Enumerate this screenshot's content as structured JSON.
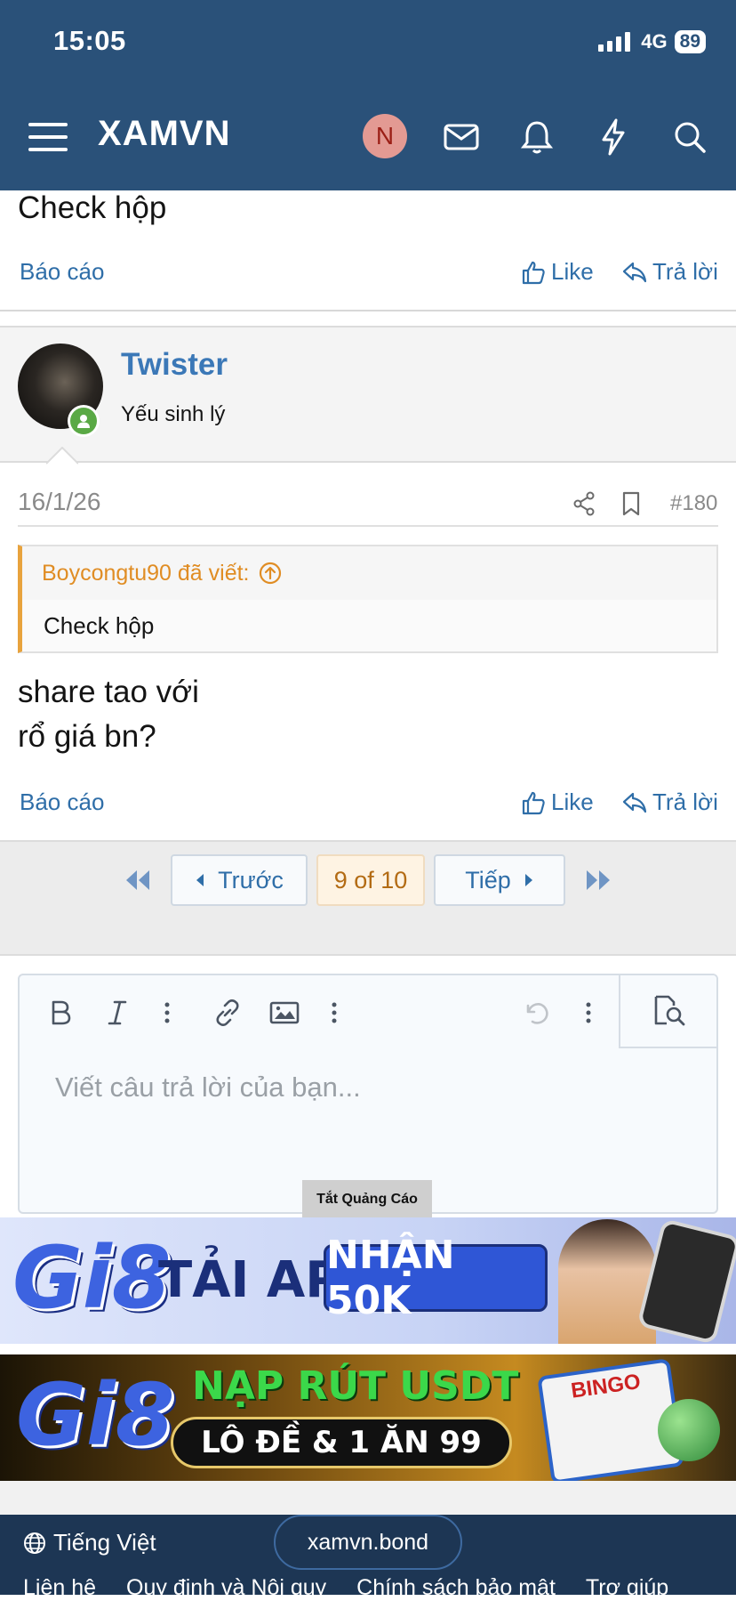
{
  "status_bar": {
    "time": "15:05",
    "network": "4G",
    "battery": "89"
  },
  "header": {
    "brand": "XAMVN",
    "avatar_letter": "N"
  },
  "prev_post": {
    "text": "Check hộp",
    "report": "Báo cáo",
    "like": "Like",
    "reply": "Trả lời"
  },
  "post": {
    "username": "Twister",
    "user_title": "Yếu sinh lý",
    "date": "16/1/26",
    "post_number": "#180",
    "quote": {
      "author": "Boycongtu90 đã viết:",
      "text": "Check hộp"
    },
    "body_line1": "share tao với",
    "body_line2": "rổ giá bn?",
    "report": "Báo cáo",
    "like": "Like",
    "reply": "Trả lời"
  },
  "pagination": {
    "prev": "Trước",
    "current": "9 of 10",
    "next": "Tiếp"
  },
  "editor": {
    "placeholder": "Viết câu trả lời của bạn..."
  },
  "ads": {
    "close_label": "Tắt Quảng Cáo",
    "ad1": {
      "logo": "Gi8",
      "text1": "TẢI APP",
      "text2": "NHẬN 50K"
    },
    "ad2": {
      "logo": "Gi8",
      "text1": "NẠP RÚT USDT",
      "text2": "LÔ ĐỀ & 1 ĂN 99",
      "text3": "BINGO"
    }
  },
  "footer": {
    "language": "Tiếng Việt",
    "domain": "xamvn.bond",
    "links": [
      "Liên hệ",
      "Quy định và Nội quy",
      "Chính sách bảo mật",
      "Trợ giúp"
    ]
  },
  "colors": {
    "header_bg": "#2a5179",
    "link": "#2f6ea8",
    "username": "#3b78b7",
    "quote_accent": "#e8a33d",
    "online": "#5aa945"
  }
}
